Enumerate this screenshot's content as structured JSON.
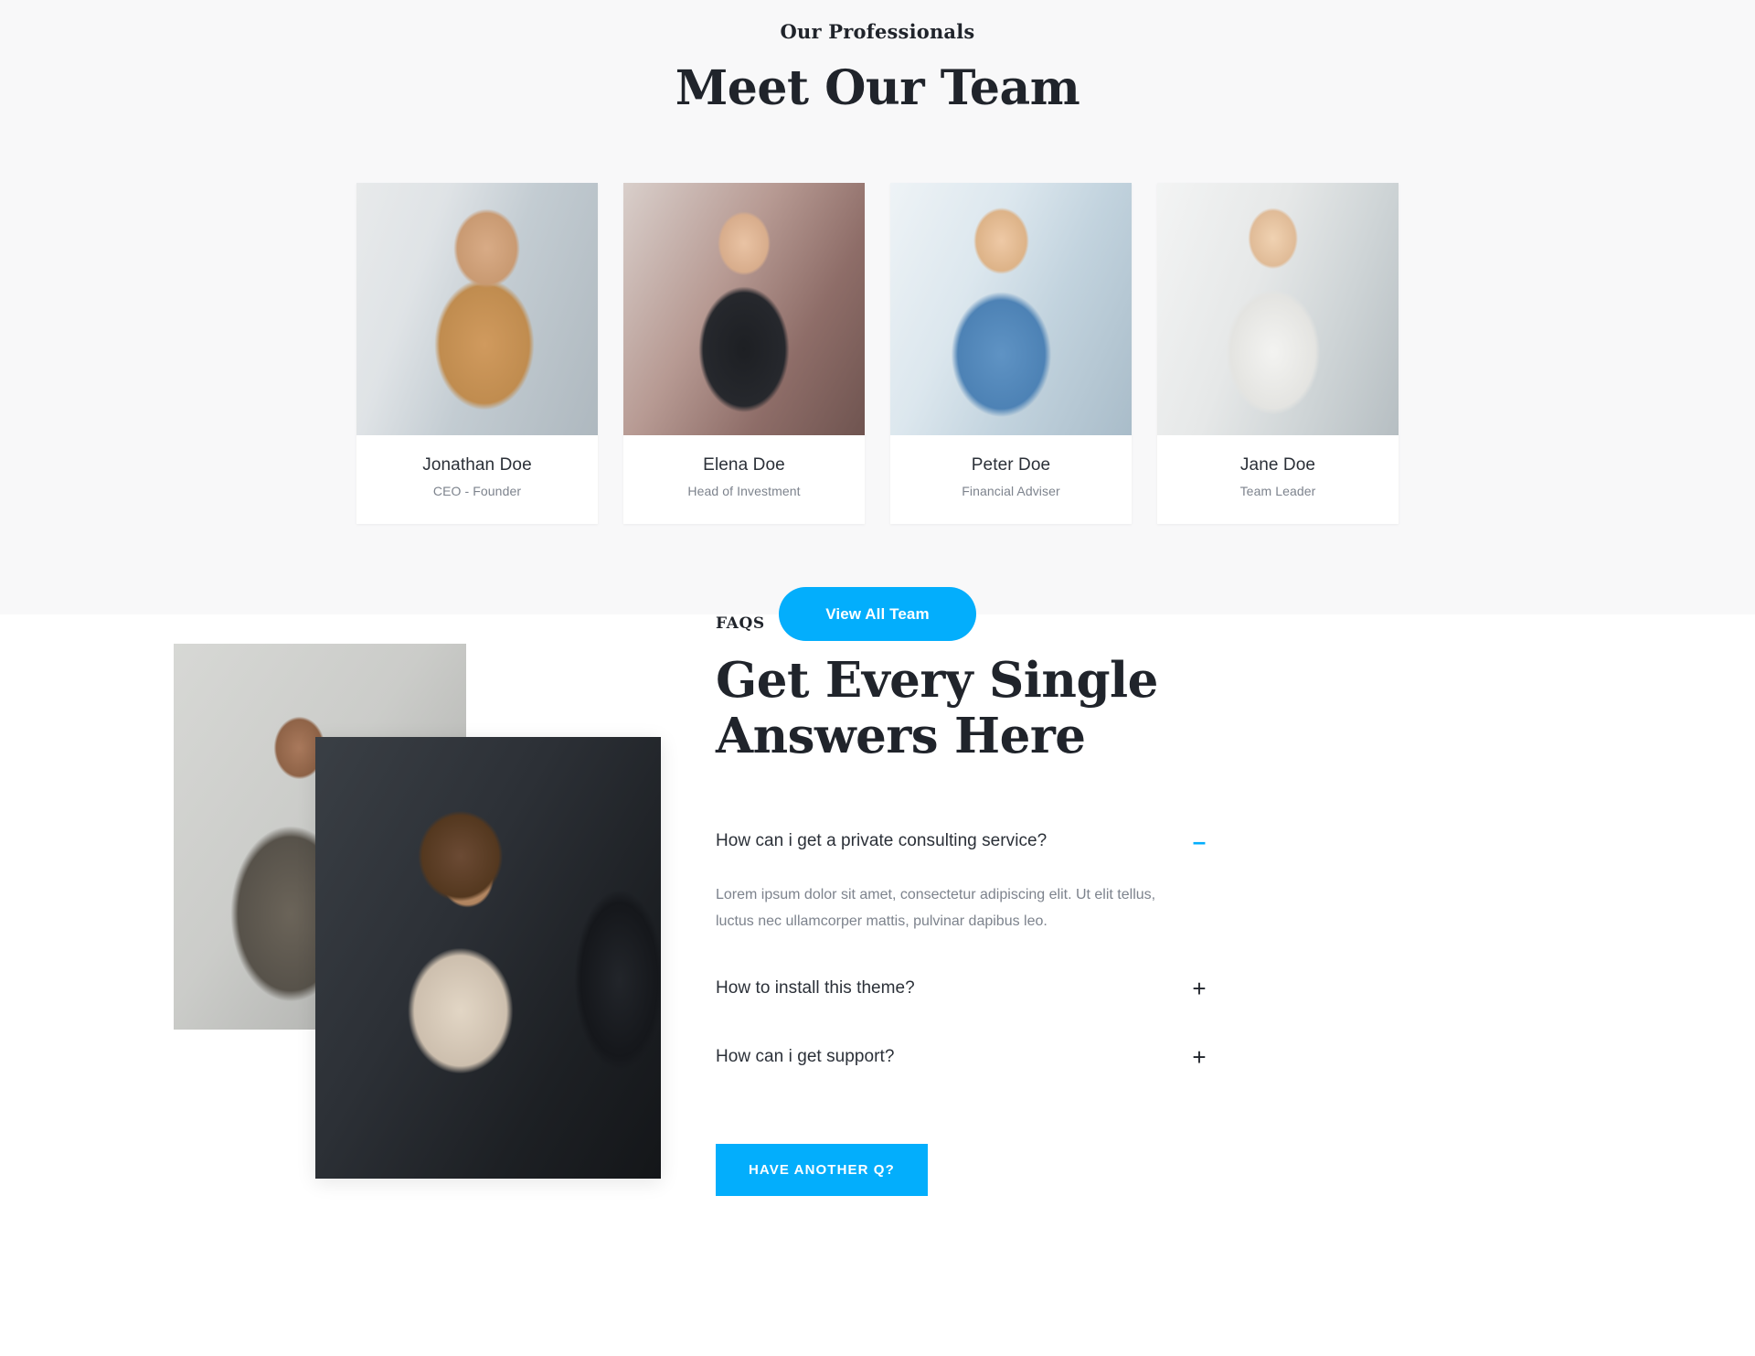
{
  "team": {
    "eyebrow": "Our Professionals",
    "title": "Meet Our Team",
    "members": [
      {
        "name": "Jonathan Doe",
        "role": "CEO - Founder",
        "photo": "man-with-glasses-arms-crossed-photo"
      },
      {
        "name": "Elena Doe",
        "role": "Head of Investment",
        "photo": "woman-in-black-blazer-photo"
      },
      {
        "name": "Peter Doe",
        "role": "Financial Adviser",
        "photo": "man-in-blue-check-shirt-photo"
      },
      {
        "name": "Jane Doe",
        "role": "Team Leader",
        "photo": "woman-in-white-blouse-photo"
      }
    ],
    "view_all_label": "View All Team"
  },
  "faq": {
    "eyebrow": "FAQS",
    "heading": "Get Every Single Answers Here",
    "media": {
      "back_photo": "man-in-tweed-jacket-photo",
      "front_photo": "business-handshake-photo"
    },
    "items": [
      {
        "question": "How can i get a private consulting service?",
        "answer": "Lorem ipsum dolor sit amet, consectetur adipiscing elit. Ut elit tellus, luctus nec ullamcorper mattis, pulvinar dapibus leo.",
        "icon": "minus-icon",
        "icon_glyph": "–",
        "open": true
      },
      {
        "question": "How to install this theme?",
        "answer": "",
        "icon": "plus-icon",
        "icon_glyph": "+",
        "open": false
      },
      {
        "question": "How can i get support?",
        "answer": "",
        "icon": "plus-icon",
        "icon_glyph": "+",
        "open": false
      }
    ],
    "cta_label": "Have Another Q?"
  },
  "colors": {
    "accent": "#03aefc",
    "section_bg": "#f8f8f9",
    "heading": "#20242b",
    "body_text": "#7d838d"
  }
}
